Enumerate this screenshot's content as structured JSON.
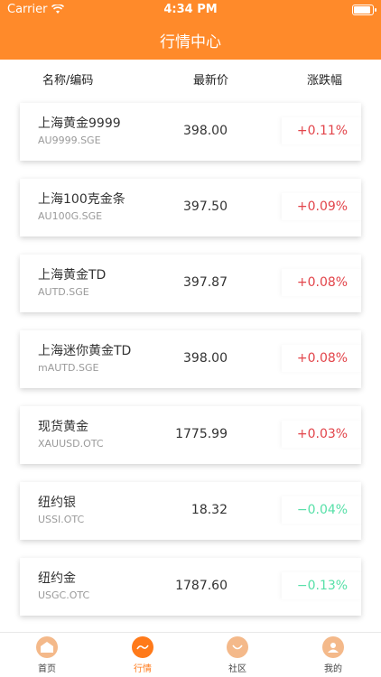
{
  "status": {
    "carrier": "Carrier",
    "time": "4:34 PM"
  },
  "nav": {
    "title": "行情中心"
  },
  "columns": {
    "name": "名称/编码",
    "price": "最新价",
    "change": "涨跌幅"
  },
  "rows": [
    {
      "name": "上海黄金9999",
      "code": "AU9999.SGE",
      "price": "398.00",
      "change": "+0.11%",
      "direction": "up"
    },
    {
      "name": "上海100克金条",
      "code": "AU100G.SGE",
      "price": "397.50",
      "change": "+0.09%",
      "direction": "up"
    },
    {
      "name": "上海黄金TD",
      "code": "AUTD.SGE",
      "price": "397.87",
      "change": "+0.08%",
      "direction": "up"
    },
    {
      "name": "上海迷你黄金TD",
      "code": "mAUTD.SGE",
      "price": "398.00",
      "change": "+0.08%",
      "direction": "up"
    },
    {
      "name": "现货黄金",
      "code": "XAUUSD.OTC",
      "price": "1775.99",
      "change": "+0.03%",
      "direction": "up"
    },
    {
      "name": "纽约银",
      "code": "USSI.OTC",
      "price": "18.32",
      "change": "−0.04%",
      "direction": "down"
    },
    {
      "name": "纽约金",
      "code": "USGC.OTC",
      "price": "1787.60",
      "change": "−0.13%",
      "direction": "down"
    }
  ],
  "tabs": [
    {
      "label": "首页",
      "icon": "home-icon"
    },
    {
      "label": "行情",
      "icon": "market-icon",
      "active": true
    },
    {
      "label": "社区",
      "icon": "community-icon"
    },
    {
      "label": "我的",
      "icon": "profile-icon"
    }
  ],
  "colors": {
    "accent": "#ff8a2a",
    "up": "#e2444a",
    "down": "#57e0a8"
  }
}
